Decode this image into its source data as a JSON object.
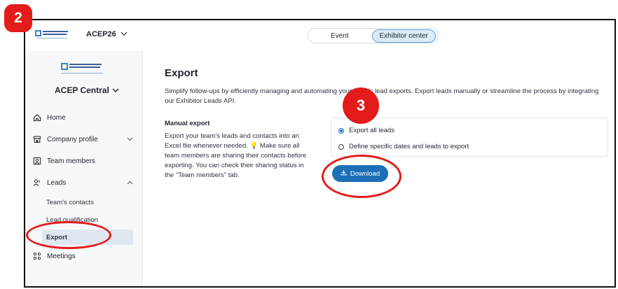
{
  "steps": {
    "badge_2": "2",
    "badge_3": "3"
  },
  "topbar": {
    "event_name": "ACEP26",
    "tabs": [
      {
        "label": "Event",
        "active": false
      },
      {
        "label": "Exhibitor center",
        "active": true
      }
    ]
  },
  "logo": {
    "line1": "American College of",
    "line2": "Emergency Physicians"
  },
  "sidebar": {
    "org_name": "ACEP Central",
    "items": [
      {
        "label": "Home",
        "icon": "home-icon"
      },
      {
        "label": "Company profile",
        "icon": "store-icon"
      },
      {
        "label": "Team members",
        "icon": "team-icon"
      },
      {
        "label": "Leads",
        "icon": "leads-icon"
      },
      {
        "label": "Meetings",
        "icon": "meetings-icon"
      }
    ],
    "leads_sub": [
      {
        "label": "Team's contacts",
        "active": false
      },
      {
        "label": "Lead qualification",
        "active": false
      },
      {
        "label": "Export",
        "active": true
      }
    ]
  },
  "main": {
    "title": "Export",
    "description": "Simplify follow-ups by efficiently managing and automating your team's lead exports. Export leads manually or streamline the process by integrating our Exhibitor Leads API.",
    "manual_export_title": "Manual export",
    "manual_export_desc": "Export your team's leads and contacts into an Excel file whenever needed. 💡 Make sure all team members are sharing their contacts before exporting. You can check their sharing status in the \"Team members\" tab.",
    "options": [
      {
        "label": "Export all leads",
        "checked": true
      },
      {
        "label": "Define specific dates and leads to export",
        "checked": false
      }
    ],
    "download_label": "Download"
  },
  "colors": {
    "accent": "#1d6fb8",
    "annotation": "#e31b1b",
    "sidebar_bg": "#f7f8f9"
  }
}
